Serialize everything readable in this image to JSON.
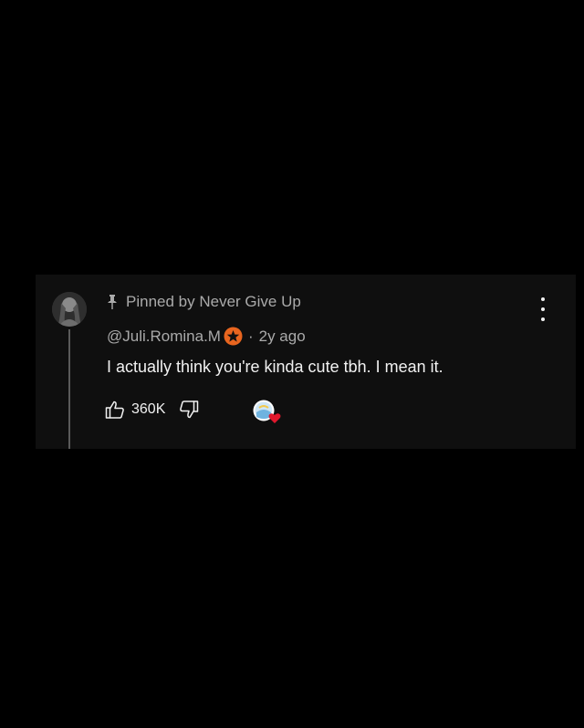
{
  "comment": {
    "pinned_label": "Pinned by Never Give Up",
    "author": "@Juli.Romina.M",
    "separator": "·",
    "time": "2y ago",
    "text": "I actually think you're kinda cute tbh. I mean it.",
    "like_count": "360K"
  },
  "icons": {
    "pin": "pin-icon",
    "badge": "star-badge-icon",
    "like": "thumbs-up-icon",
    "dislike": "thumbs-down-icon",
    "heart": "creator-heart-icon",
    "more": "more-vertical-icon"
  },
  "colors": {
    "background": "#000000",
    "card": "#0f0f0f",
    "text_primary": "#f1f1f1",
    "text_secondary": "#aaaaaa",
    "badge": "#e8651f",
    "heart": "#e0182d"
  }
}
